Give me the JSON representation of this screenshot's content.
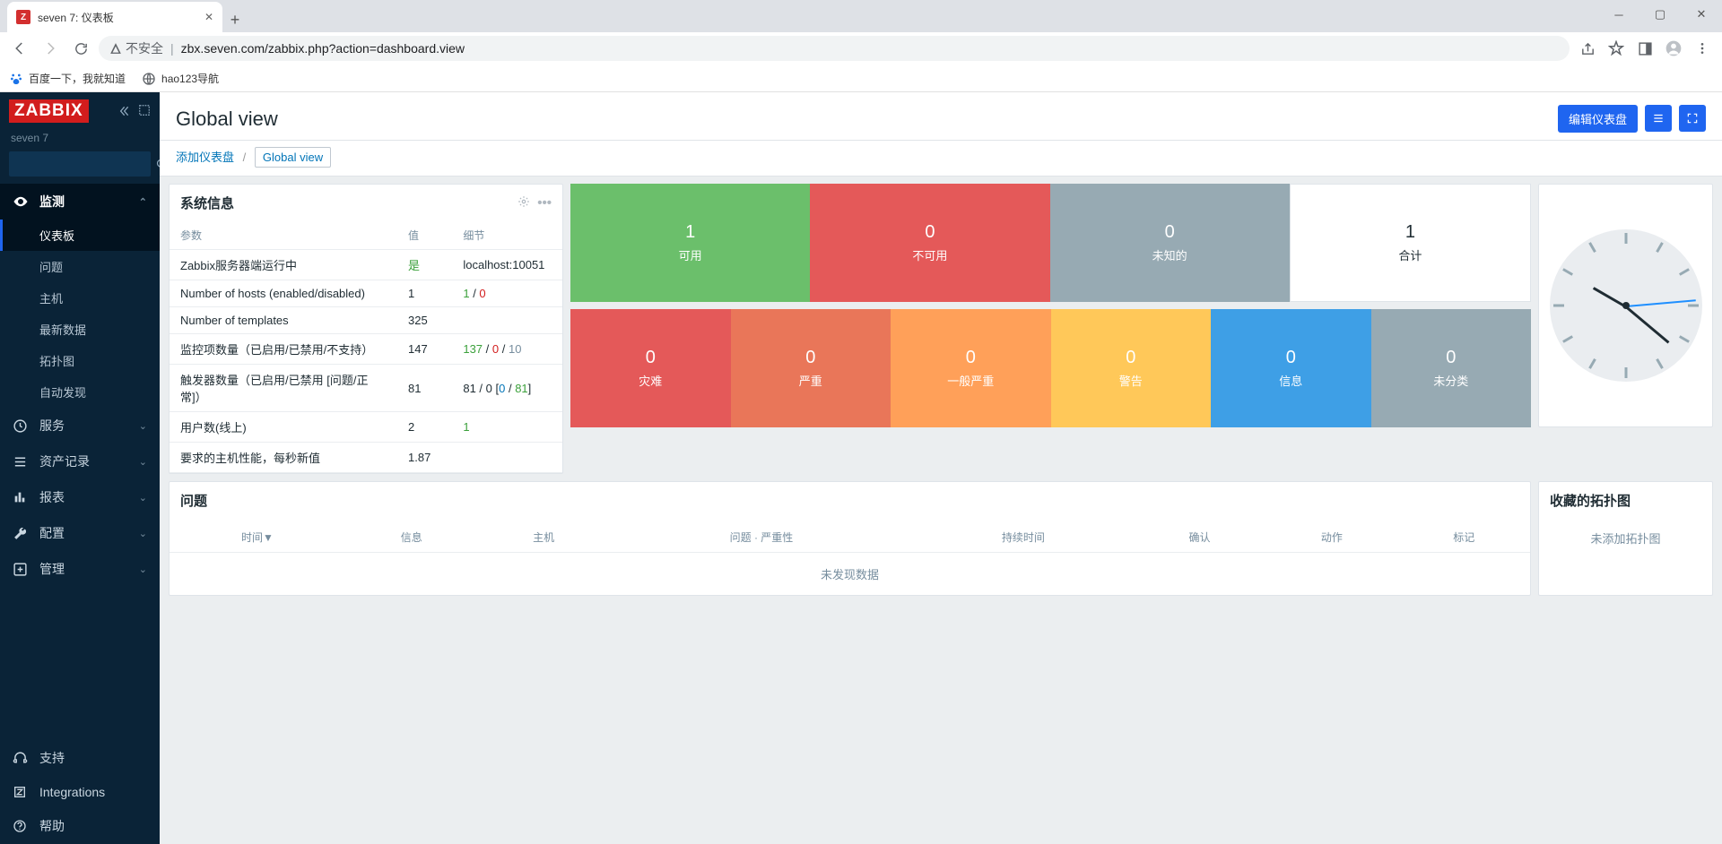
{
  "browser": {
    "tab_title": "seven 7: 仪表板",
    "url_insecure": "不安全",
    "url": "zbx.seven.com/zabbix.php?action=dashboard.view",
    "bookmarks": {
      "baidu": "百度一下，我就知道",
      "hao123": "hao123导航"
    }
  },
  "sidebar": {
    "logo": "ZABBIX",
    "server": "seven 7",
    "sections": [
      {
        "icon": "eye",
        "label": "监测",
        "expanded": true,
        "active": true,
        "children": [
          {
            "label": "仪表板",
            "active": true
          },
          {
            "label": "问题"
          },
          {
            "label": "主机"
          },
          {
            "label": "最新数据"
          },
          {
            "label": "拓扑图"
          },
          {
            "label": "自动发现"
          }
        ]
      },
      {
        "icon": "clock",
        "label": "服务"
      },
      {
        "icon": "list",
        "label": "资产记录"
      },
      {
        "icon": "chart",
        "label": "报表"
      },
      {
        "icon": "wrench",
        "label": "配置"
      },
      {
        "icon": "gear",
        "label": "管理"
      }
    ],
    "footer": [
      {
        "icon": "support",
        "label": "支持"
      },
      {
        "icon": "z",
        "label": "Integrations"
      },
      {
        "icon": "help",
        "label": "帮助"
      }
    ]
  },
  "header": {
    "title": "Global view",
    "edit_button": "编辑仪表盘"
  },
  "breadcrumb": {
    "add": "添加仪表盘",
    "current": "Global view"
  },
  "sysinfo": {
    "title": "系统信息",
    "cols": {
      "param": "参数",
      "value": "值",
      "details": "细节"
    },
    "rows": [
      {
        "param": "Zabbix服务器端运行中",
        "value": "是",
        "value_class": "green",
        "details": "localhost:10051"
      },
      {
        "param": "Number of hosts (enabled/disabled)",
        "value": "1",
        "details_html": [
          [
            "1",
            "green"
          ],
          [
            " / ",
            ""
          ],
          [
            "0",
            "red"
          ]
        ]
      },
      {
        "param": "Number of templates",
        "value": "325",
        "details": ""
      },
      {
        "param": "监控项数量（已启用/已禁用/不支持）",
        "value": "147",
        "details_html": [
          [
            "137",
            "green"
          ],
          [
            " / ",
            ""
          ],
          [
            "0",
            "red"
          ],
          [
            " / ",
            ""
          ],
          [
            "10",
            "gray"
          ]
        ]
      },
      {
        "param": "触发器数量（已启用/已禁用 [问题/正常]）",
        "value": "81",
        "details_html": [
          [
            "81",
            ""
          ],
          [
            " / ",
            ""
          ],
          [
            "0",
            ""
          ],
          [
            " [",
            ""
          ],
          [
            "0",
            "blue"
          ],
          [
            " / ",
            ""
          ],
          [
            "81",
            "green"
          ],
          [
            "]",
            ""
          ]
        ]
      },
      {
        "param": "用户数(线上)",
        "value": "2",
        "details_html": [
          [
            "1",
            "green"
          ]
        ]
      },
      {
        "param": "要求的主机性能，每秒新值",
        "value": "1.87",
        "details": ""
      }
    ]
  },
  "host_tiles": [
    {
      "value": "1",
      "label": "可用",
      "cls": "green-bg"
    },
    {
      "value": "0",
      "label": "不可用",
      "cls": "red-bg"
    },
    {
      "value": "0",
      "label": "未知的",
      "cls": "gray-bg"
    },
    {
      "value": "1",
      "label": "合计",
      "cls": "white-bg"
    }
  ],
  "severity": [
    {
      "value": "0",
      "label": "灾难",
      "cls": "disaster"
    },
    {
      "value": "0",
      "label": "严重",
      "cls": "high"
    },
    {
      "value": "0",
      "label": "一般严重",
      "cls": "average"
    },
    {
      "value": "0",
      "label": "警告",
      "cls": "warning"
    },
    {
      "value": "0",
      "label": "信息",
      "cls": "info"
    },
    {
      "value": "0",
      "label": "未分类",
      "cls": "uncl"
    }
  ],
  "problems": {
    "title": "问题",
    "cols": [
      "时间▼",
      "信息",
      "主机",
      "问题 · 严重性",
      "持续时间",
      "确认",
      "动作",
      "标记"
    ],
    "empty": "未发现数据"
  },
  "favmaps": {
    "title": "收藏的拓扑图",
    "empty": "未添加拓扑图"
  }
}
